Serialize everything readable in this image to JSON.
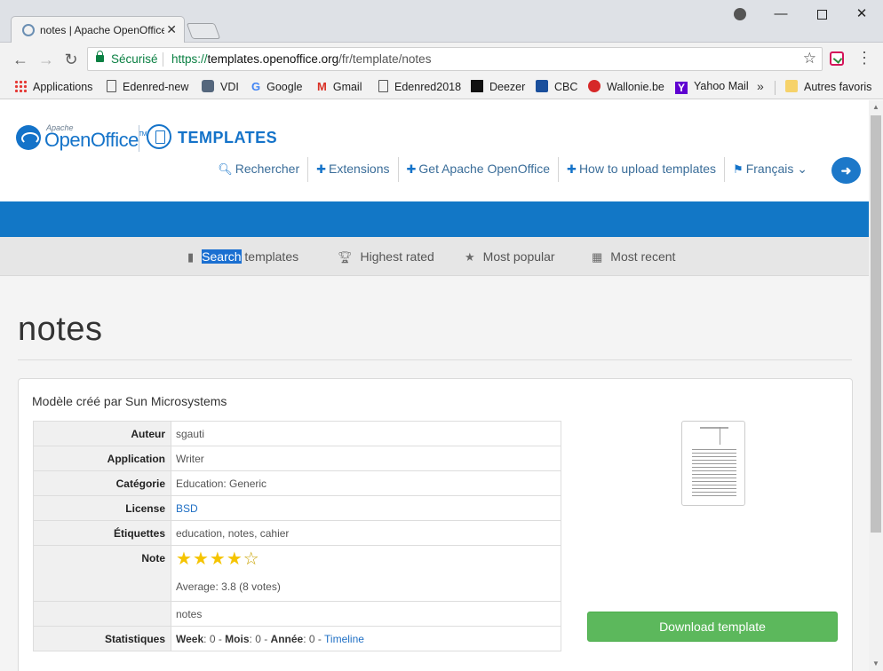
{
  "browser": {
    "tab_title": "notes | Apache OpenOffice Templates",
    "secure_label": "Sécurisé",
    "url": {
      "scheme": "https://",
      "host": "templates.openoffice.org",
      "path": "/fr/template/notes"
    },
    "bookmarks": [
      "Applications",
      "Edenred-new",
      "VDI",
      "Google",
      "Gmail",
      "Edenred2018",
      "Deezer",
      "CBC",
      "Wallonie.be",
      "Yahoo Mail"
    ],
    "more_bookmarks": "»",
    "other_bookmarks": "Autres favoris"
  },
  "site": {
    "apache": "Apache",
    "brand": "OpenOffice",
    "tm": "TM",
    "templates": "TEMPLATES",
    "nav": [
      "Rechercher",
      "Extensions",
      "Get Apache OpenOffice",
      "How to upload templates",
      "Français"
    ],
    "subnav": {
      "search_highlight": "Search",
      "search_rest": " templates",
      "highest": "Highest rated",
      "popular": "Most popular",
      "recent": "Most recent"
    }
  },
  "template": {
    "title": "notes",
    "subtitle": "Modèle créé par Sun Microsystems",
    "rows": {
      "author_label": "Auteur",
      "author": "sgauti",
      "application_label": "Application",
      "application": "Writer",
      "category_label": "Catégorie",
      "category": "Education: Generic",
      "license_label": "License",
      "license": "BSD",
      "tags_label": "Étiquettes",
      "tags": "education, notes, cahier",
      "rating_label": "Note",
      "rating_value": 4,
      "rating_max": 5,
      "average": "Average: 3.8 (8 votes)",
      "extra": "notes",
      "stats_label": "Statistiques",
      "week_label": "Week",
      "week": "0",
      "month_label": "Mois",
      "month": "0",
      "year_label": "Année",
      "year": "0",
      "timeline": "Timeline"
    },
    "download": "Download template"
  },
  "colors": {
    "brand_blue": "#1277c6",
    "download_green": "#5cb85c",
    "star": "#f5c400"
  }
}
